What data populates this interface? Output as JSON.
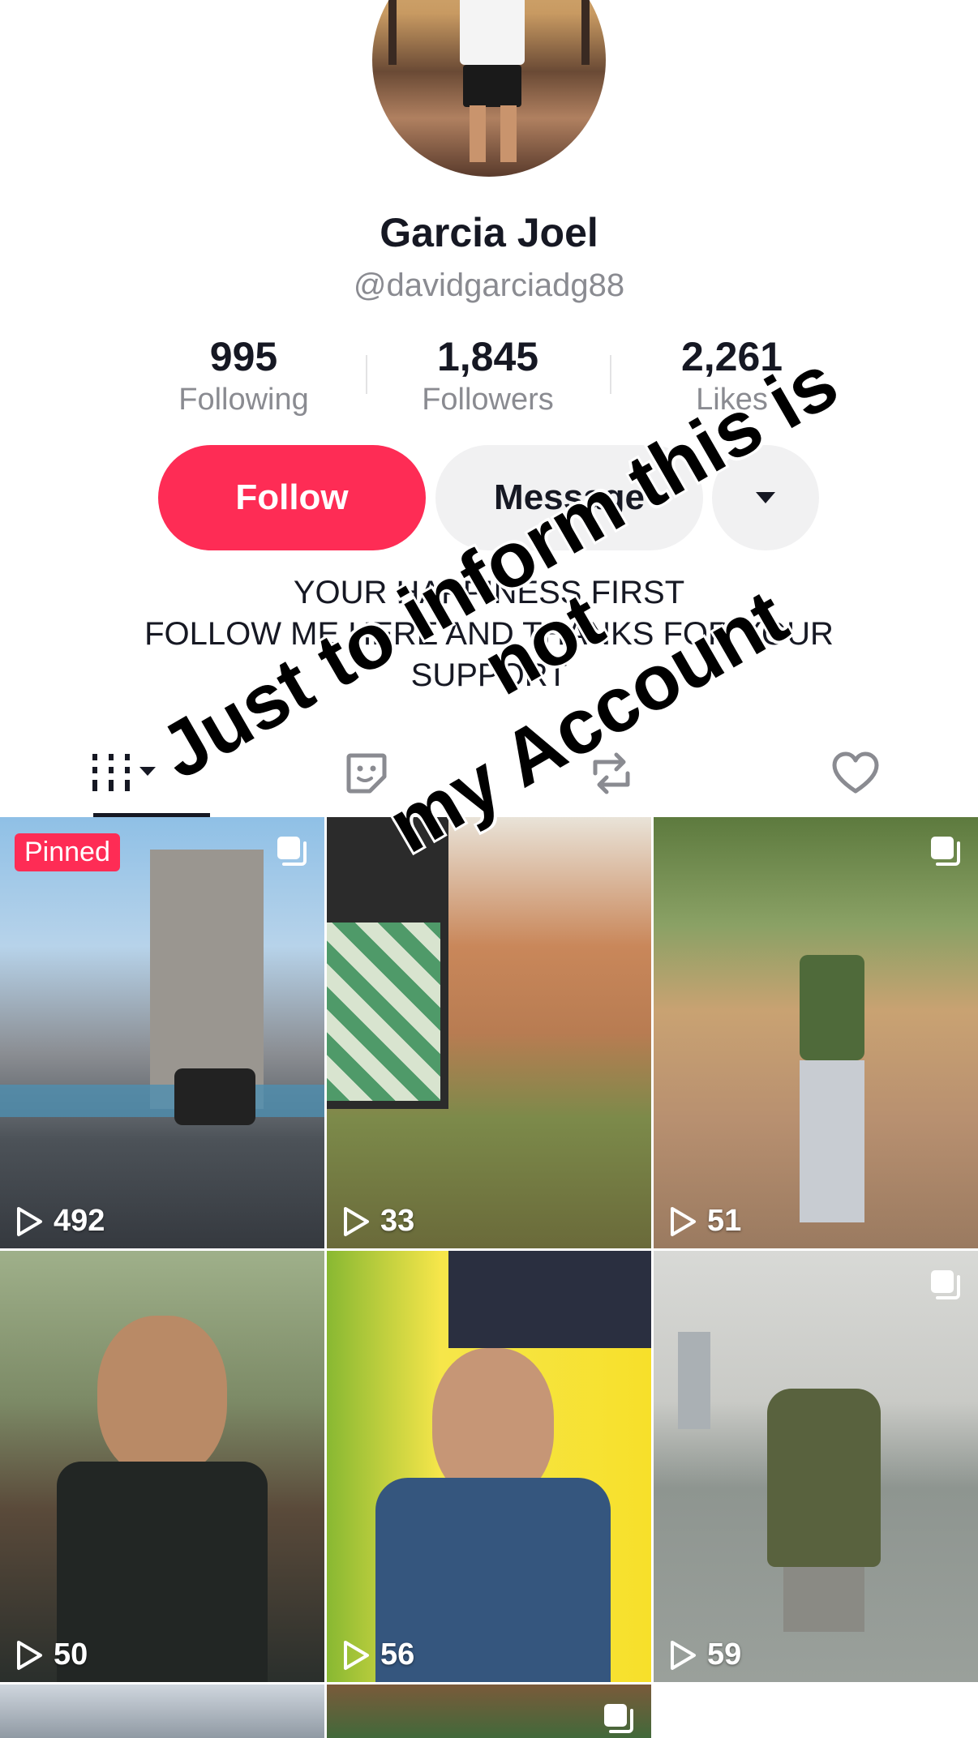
{
  "profile": {
    "display_name": "Garcia Joel",
    "username": "@davidgarciadg88",
    "bio_lines": [
      "YOUR HAPPINESS FIRST",
      "FOLLOW ME HERE AND THANKS FOR YOUR",
      "SUPPORT"
    ]
  },
  "stats": {
    "following": {
      "value": "995",
      "label": "Following"
    },
    "followers": {
      "value": "1,845",
      "label": "Followers"
    },
    "likes": {
      "value": "2,261",
      "label": "Likes"
    }
  },
  "actions": {
    "follow_label": "Follow",
    "message_label": "Message",
    "more_icon": "triangle-down-icon"
  },
  "tabs": [
    {
      "icon": "videos-grid-icon",
      "active": true
    },
    {
      "icon": "sticker-icon",
      "active": false
    },
    {
      "icon": "repost-icon",
      "active": false
    },
    {
      "icon": "heart-icon",
      "active": false
    }
  ],
  "videos": [
    {
      "views": "492",
      "pinned": true,
      "pinned_label": "Pinned",
      "multi": true
    },
    {
      "views": "33",
      "pinned": false,
      "multi": false
    },
    {
      "views": "51",
      "pinned": false,
      "multi": true
    },
    {
      "views": "50",
      "pinned": false,
      "multi": false
    },
    {
      "views": "56",
      "pinned": false,
      "multi": false
    },
    {
      "views": "59",
      "pinned": false,
      "multi": true
    }
  ],
  "overlay_text": [
    "Just to inform this is not",
    "my Account"
  ],
  "colors": {
    "accent": "#fe2c55",
    "text": "#161823",
    "muted": "#8a8b91",
    "button_bg": "#f1f1f2"
  }
}
